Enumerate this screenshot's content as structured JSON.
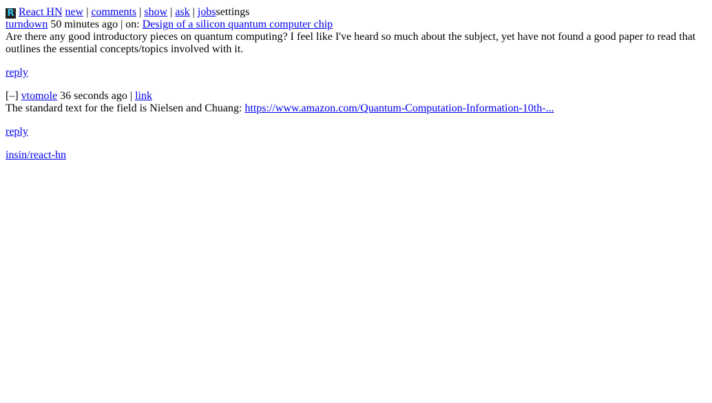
{
  "header": {
    "logo_letter": "R",
    "brand": "React HN",
    "nav": [
      "new",
      "comments",
      "show",
      "ask",
      "jobs"
    ],
    "settings": "settings",
    "separator": "|"
  },
  "item": {
    "author": "turndown",
    "time": "50 minutes ago",
    "on_prefix": "| on:",
    "story_title": "Design of a silicon quantum computer chip",
    "text": "Are there any good introductory pieces on quantum computing? I feel like I've heard so much about the subject, yet have not found a good paper to read that outlines the essential concepts/topics involved with it.",
    "reply": "reply"
  },
  "comment": {
    "collapse": "[–]",
    "author": "vtomole",
    "time": "36 seconds ago",
    "separator": "|",
    "link_label": "link",
    "text_prefix": "The standard text for the field is Nielsen and Chuang: ",
    "url_text": "https://www.amazon.com/Quantum-Computation-Information-10th-...",
    "reply": "reply"
  },
  "footer": {
    "repo_link": "insin/react-hn"
  }
}
